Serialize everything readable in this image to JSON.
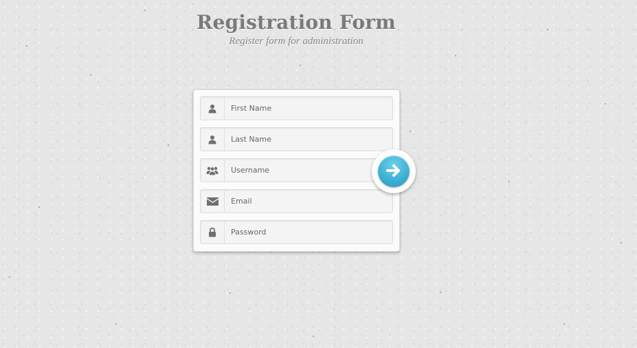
{
  "header": {
    "title": "Registration Form",
    "subtitle": "Register form for administration"
  },
  "form": {
    "fields": [
      {
        "placeholder": "First Name",
        "value": "",
        "icon": "user-icon",
        "type": "text"
      },
      {
        "placeholder": "Last Name",
        "value": "",
        "icon": "user-icon",
        "type": "text"
      },
      {
        "placeholder": "Username",
        "value": "",
        "icon": "users-icon",
        "type": "text"
      },
      {
        "placeholder": "Email",
        "value": "",
        "icon": "envelope-icon",
        "type": "text"
      },
      {
        "placeholder": "Password",
        "value": "",
        "icon": "lock-icon",
        "type": "password"
      }
    ],
    "submit_icon": "arrow-right-icon"
  },
  "colors": {
    "accent": "#3fb2d5",
    "icon": "#6f6f6f",
    "title": "#7a7a7a",
    "background": "#e6e6e6"
  }
}
